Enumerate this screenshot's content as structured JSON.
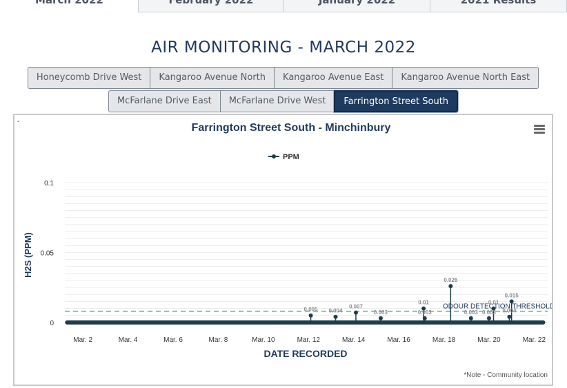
{
  "tabs": [
    {
      "label": "March 2022",
      "active": true
    },
    {
      "label": "February 2022",
      "active": false
    },
    {
      "label": "January 2022",
      "active": false
    },
    {
      "label": "2021 Results",
      "active": false
    }
  ],
  "page_title": "AIR MONITORING - MARCH 2022",
  "locations": [
    {
      "label": "Honeycomb Drive West",
      "active": false
    },
    {
      "label": "Kangaroo Avenue North",
      "active": false
    },
    {
      "label": "Kangaroo Avenue East",
      "active": false
    },
    {
      "label": "Kangaroo Avenue North East",
      "active": false
    },
    {
      "label": "McFarlane Drive East",
      "active": false
    },
    {
      "label": "McFarlane Drive West",
      "active": false
    },
    {
      "label": "Farrington Street South",
      "active": true
    }
  ],
  "chart_corner_mark": "-",
  "menu_icon": "hamburger-menu-icon",
  "colors": {
    "title": "#1f3a5f",
    "accent": "#14294a",
    "series": "#1c3d4a",
    "threshold": "#2ecc71"
  },
  "footnote": "*Note - Community location",
  "chart_data": {
    "type": "line",
    "title": "Farrington Street South - Minchinbury",
    "xlabel": "DATE RECORDED",
    "ylabel": "H2S (PPM)",
    "legend": [
      "PPM"
    ],
    "legend_position": "top-center",
    "xlim": [
      1.2,
      22.6
    ],
    "ylim": [
      -0.005,
      0.1
    ],
    "y_ticks": [
      0,
      0.05,
      0.1
    ],
    "y_tick_labels": [
      "0",
      "0.05",
      "0.1"
    ],
    "x_ticks": [
      2,
      4,
      6,
      8,
      10,
      12,
      14,
      16,
      18,
      20,
      22
    ],
    "x_tick_labels": [
      "Mar. 2",
      "Mar. 4",
      "Mar. 6",
      "Mar. 8",
      "Mar. 10",
      "Mar. 12",
      "Mar. 14",
      "Mar. 16",
      "Mar. 18",
      "Mar. 20",
      "Mar. 22"
    ],
    "grid": true,
    "threshold": {
      "label": "ODOUR DETECTION THRESHOLD",
      "value": 0.008
    },
    "series": [
      {
        "name": "PPM",
        "baseline_range": [
          1.3,
          22.4
        ],
        "points": [
          {
            "x": 12.1,
            "y": 0.005,
            "label": "0.005"
          },
          {
            "x": 13.2,
            "y": 0.004,
            "label": "0.004"
          },
          {
            "x": 14.1,
            "y": 0.007,
            "label": "0.007"
          },
          {
            "x": 15.2,
            "y": 0.003,
            "label": "0.003"
          },
          {
            "x": 17.1,
            "y": 0.01,
            "label": "0.01"
          },
          {
            "x": 17.15,
            "y": 0.003,
            "label": "0.003"
          },
          {
            "x": 18.3,
            "y": 0.026,
            "label": "0.026"
          },
          {
            "x": 19.2,
            "y": 0.003,
            "label": "0.003"
          },
          {
            "x": 20.0,
            "y": 0.003,
            "label": "0.003"
          },
          {
            "x": 20.2,
            "y": 0.01,
            "label": "0.01"
          },
          {
            "x": 20.9,
            "y": 0.004,
            "label": "0.004"
          },
          {
            "x": 21.0,
            "y": 0.015,
            "label": "0.015"
          }
        ]
      }
    ]
  }
}
